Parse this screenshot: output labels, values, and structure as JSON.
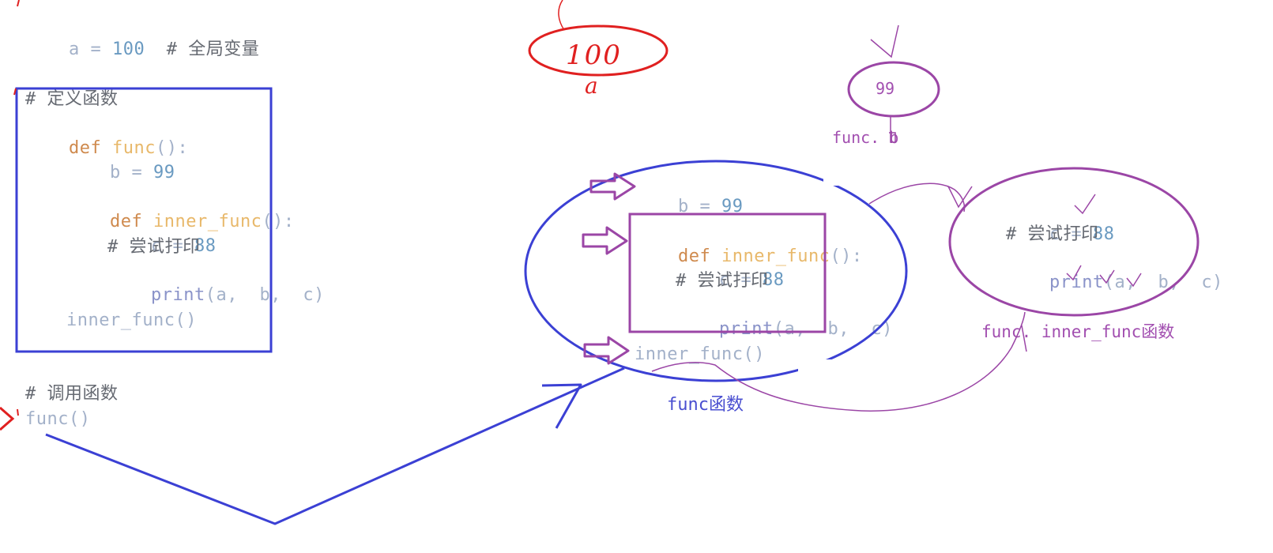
{
  "left_code": {
    "global_line": {
      "var": "a",
      "op": " = ",
      "num": "100",
      "comment": "  # 全局变量"
    },
    "define_comment": "# 定义函数",
    "def_line": {
      "kw": "def",
      "name": " func",
      "paren": "():"
    },
    "b_line": {
      "var": "b",
      "op": " = ",
      "num": "99"
    },
    "inner_def_line": {
      "kw": "def",
      "name": " inner_func",
      "paren": "():"
    },
    "c_line": {
      "var": "c",
      "op": " = ",
      "num": "88"
    },
    "try_print_comment": "# 尝试打印",
    "print_line": {
      "fn": "print",
      "args": "(a,  b,  c)"
    },
    "inner_call": "inner_func()",
    "call_comment": "# 调用函数",
    "func_call": "func()"
  },
  "middle_code": {
    "b_line": {
      "var": "b",
      "op": " = ",
      "num": "99"
    },
    "inner_def_line": {
      "kw": "def",
      "name": " inner_func",
      "paren": "():"
    },
    "c_line": {
      "var": "c",
      "op": " = ",
      "num": "88"
    },
    "try_print_comment": "# 尝试打印",
    "print_line": {
      "fn": "print",
      "args": "(a,  b,  c)"
    },
    "inner_call": "inner_func()",
    "scope_label": "func函数"
  },
  "right_code": {
    "c_line": {
      "var": "c",
      "op": " = ",
      "num": "88"
    },
    "try_print_comment": "# 尝试打印",
    "print_line": {
      "fn": "print",
      "args": "(a,  b,  c)"
    },
    "scope_label": "func. inner_func函数"
  },
  "annotations": {
    "handwritten_value": "100",
    "handwritten_var": "a",
    "b_bubble_value": "99",
    "b_bubble_label": "func. b"
  },
  "colors": {
    "red": "#e02020",
    "blue": "#3b40d4",
    "purple": "#9b46a6"
  }
}
